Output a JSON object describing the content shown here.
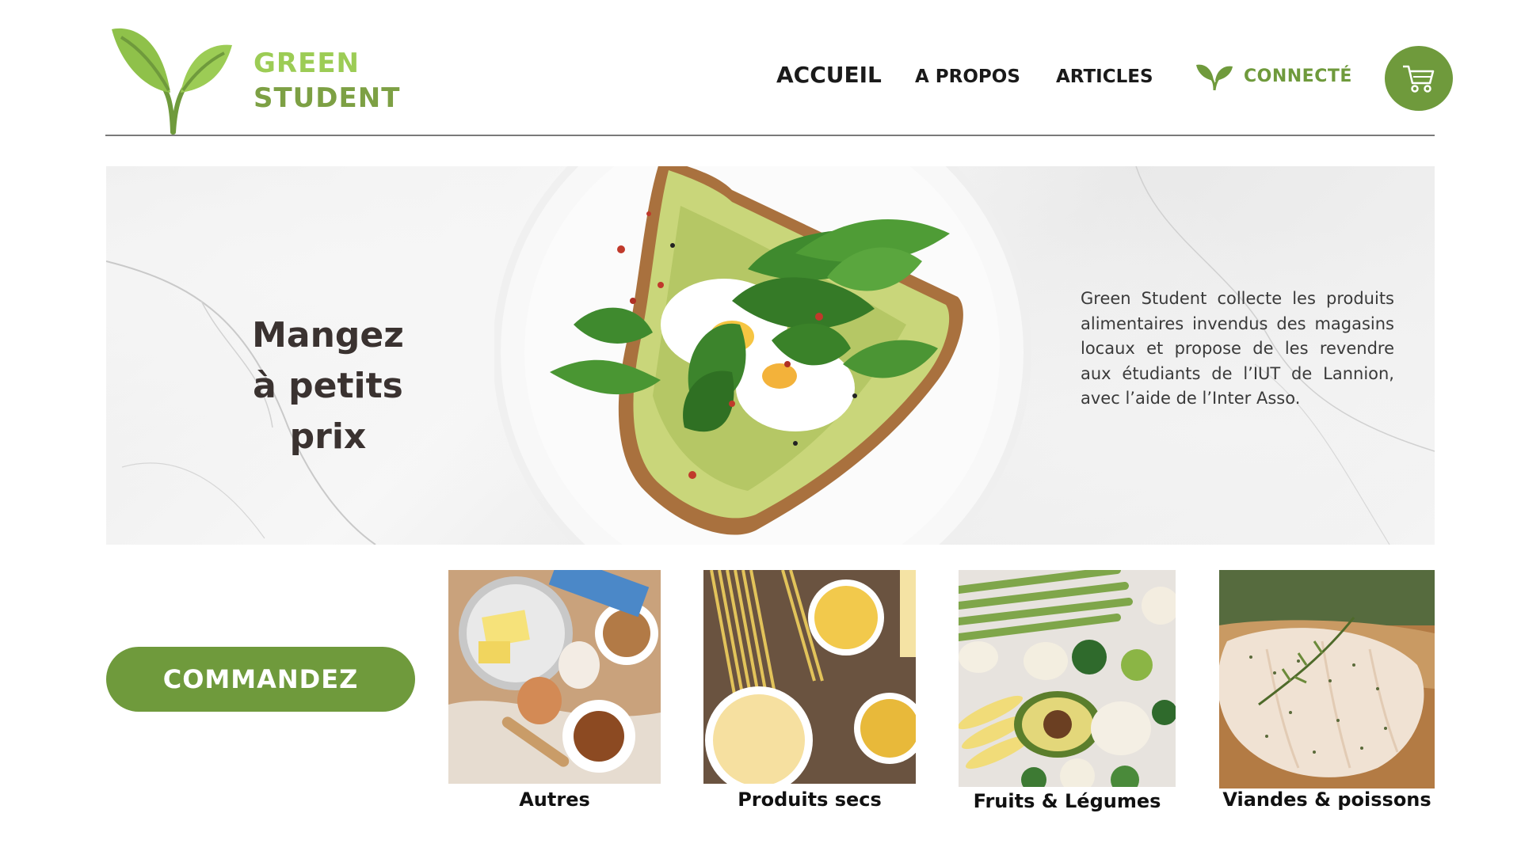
{
  "brand": {
    "line1": "GREEN",
    "line2": "STUDENT"
  },
  "nav": {
    "accueil": "ACCUEIL",
    "a_propos": "A PROPOS",
    "articles": "ARTICLES",
    "connect": "CONNECTÉ"
  },
  "hero": {
    "title_line1": "Mangez",
    "title_line2": "à petits prix",
    "description": "Green Student collecte les produits alimentaires invendus des magasins locaux et propose de les revendre aux étudiants de l’IUT de Lannion, avec l’aide de l’Inter Asso."
  },
  "order_button": "COMMANDEZ",
  "categories": [
    {
      "label": "Autres",
      "icon": "baking-ingredients-photo"
    },
    {
      "label": "Produits secs",
      "icon": "pasta-photo"
    },
    {
      "label": "Fruits & Légumes",
      "icon": "vegetables-photo"
    },
    {
      "label": "Viandes & poissons",
      "icon": "chicken-photo"
    }
  ],
  "colors": {
    "brand_green": "#6f9a3c",
    "light_green": "#9ccc55",
    "text_dark": "#1a1a1a"
  }
}
